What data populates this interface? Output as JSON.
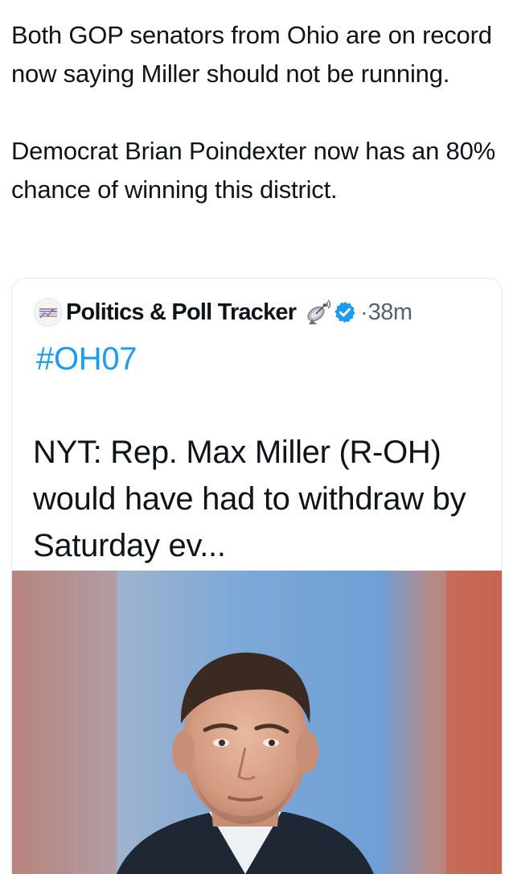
{
  "tweet": {
    "paragraph_1": "Both GOP senators from Ohio are on record now saying Miller should not be running.",
    "paragraph_2": "Democrat Brian Poindexter now has an 80% chance of winning this district."
  },
  "quoted_post": {
    "author_name": "Politics & Poll Tracker",
    "author_icon": "satellite-dish-icon",
    "verified_icon": "verified-badge-icon",
    "separator": "·",
    "timestamp": "38m",
    "hashtag": "#OH07",
    "text": "NYT: Rep. Max Miller (R-OH) would have had to withdraw by Saturday ev...",
    "media_alt": "photo-of-man-in-suit"
  },
  "colors": {
    "link": "#1d9bf0",
    "text": "#0f1419",
    "muted": "#536471",
    "border": "#e4e8ec"
  }
}
